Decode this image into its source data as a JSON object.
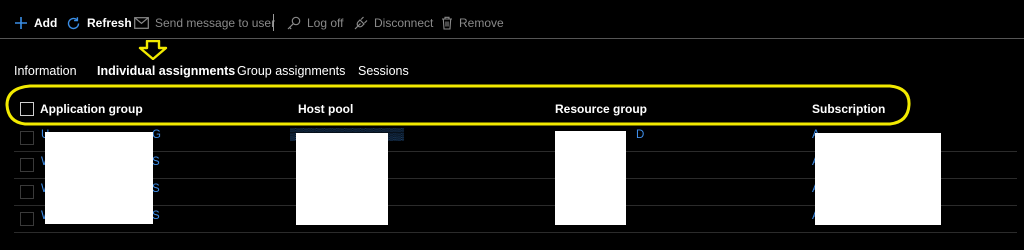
{
  "toolbar": {
    "add": {
      "label": "Add",
      "icon": "plus-icon"
    },
    "refresh": {
      "label": "Refresh",
      "icon": "refresh-icon"
    },
    "send_message": {
      "label": "Send message to user",
      "icon": "mail-icon"
    },
    "log_off": {
      "label": "Log off",
      "icon": "key-icon"
    },
    "disconnect": {
      "label": "Disconnect",
      "icon": "plug-icon"
    },
    "remove": {
      "label": "Remove",
      "icon": "trash-icon"
    }
  },
  "tabs": [
    {
      "label": "Information",
      "active": false
    },
    {
      "label": "Individual assignments",
      "active": true
    },
    {
      "label": "Group assignments",
      "active": false
    },
    {
      "label": "Sessions",
      "active": false
    }
  ],
  "table": {
    "columns": [
      "Application group",
      "Host pool",
      "Resource group",
      "Subscription"
    ],
    "rows": [
      {
        "application_group": "U",
        "application_group_tail": "G",
        "host_pool": "",
        "resource_group": "D",
        "subscription": "A"
      },
      {
        "application_group": "W",
        "application_group_tail": "S",
        "host_pool": "",
        "resource_group": "",
        "subscription": "A"
      },
      {
        "application_group": "W",
        "application_group_tail": "S",
        "host_pool": "",
        "resource_group": "",
        "subscription": "A"
      },
      {
        "application_group": "W",
        "application_group_tail": "S",
        "host_pool": "",
        "resource_group": "",
        "subscription": "A"
      }
    ]
  },
  "colors": {
    "background": "#000000",
    "link": "#3f8ee8",
    "accent_blue": "#3a8ee6",
    "annotation_yellow": "#f2ea00",
    "disabled_text": "#8a8a8a"
  }
}
